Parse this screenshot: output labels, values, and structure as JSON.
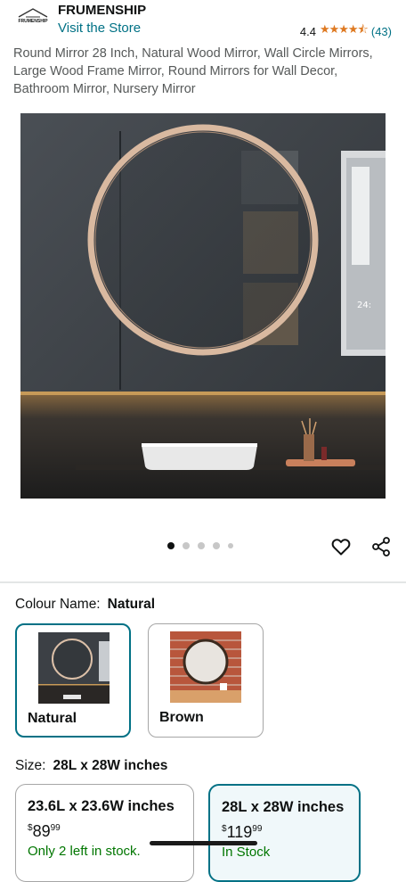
{
  "header": {
    "logo_text": "FRUMENSHIP",
    "brand": "FRUMENSHIP",
    "visit_store": "Visit the Store",
    "rating": "4.4",
    "stars": 4.4,
    "review_count": "(43)"
  },
  "product": {
    "title": "Round Mirror 28 Inch, Natural Wood Mirror, Wall Circle Mirrors, Large Wood Frame Mirror, Round Mirrors for Wall Decor, Bathroom Mirror, Nursery Mirror"
  },
  "gallery": {
    "total_images": 5,
    "current_image": 1
  },
  "colour": {
    "label": "Colour Name:",
    "selected": "Natural",
    "options": [
      {
        "name": "Natural",
        "selected": true
      },
      {
        "name": "Brown",
        "selected": false
      }
    ]
  },
  "size": {
    "label": "Size:",
    "selected": "28L x 28W inches",
    "options": [
      {
        "name": "23.6L x 23.6W inches",
        "currency": "$",
        "price_whole": "89",
        "price_fraction": "99",
        "stock": "Only 2 left in stock.",
        "selected": false
      },
      {
        "name": "28L x 28W inches",
        "currency": "$",
        "price_whole": "119",
        "price_fraction": "99",
        "stock": "In Stock",
        "selected": true
      }
    ]
  },
  "colors": {
    "link": "#007185",
    "star": "#de7921",
    "in_stock": "#007600",
    "selected_border": "#007185"
  }
}
